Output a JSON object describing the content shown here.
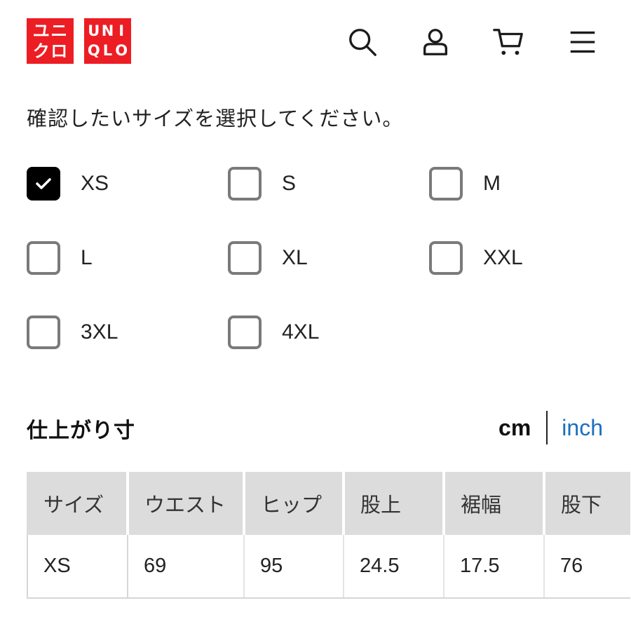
{
  "header": {
    "logo_kana": [
      "ユ",
      "ニ",
      "ク",
      "ロ"
    ],
    "logo_latin": [
      "U",
      "N",
      "I",
      "Q",
      "L",
      "O"
    ],
    "brand_color": "#ed1d24",
    "icons": [
      "search-icon",
      "account-icon",
      "cart-icon",
      "menu-icon"
    ]
  },
  "instruction": "確認したいサイズを選択してください。",
  "sizes": [
    {
      "label": "XS",
      "checked": true
    },
    {
      "label": "S",
      "checked": false
    },
    {
      "label": "M",
      "checked": false
    },
    {
      "label": "L",
      "checked": false
    },
    {
      "label": "XL",
      "checked": false
    },
    {
      "label": "XXL",
      "checked": false
    },
    {
      "label": "3XL",
      "checked": false
    },
    {
      "label": "4XL",
      "checked": false
    }
  ],
  "section": {
    "title": "仕上がり寸",
    "unit_cm": "cm",
    "unit_inch": "inch",
    "active_unit": "cm",
    "link_color": "#1a6fbf"
  },
  "table": {
    "headers": [
      "サイズ",
      "ウエスト",
      "ヒップ",
      "股上",
      "裾幅",
      "股下"
    ],
    "rows": [
      [
        "XS",
        "69",
        "95",
        "24.5",
        "17.5",
        "76"
      ]
    ]
  }
}
